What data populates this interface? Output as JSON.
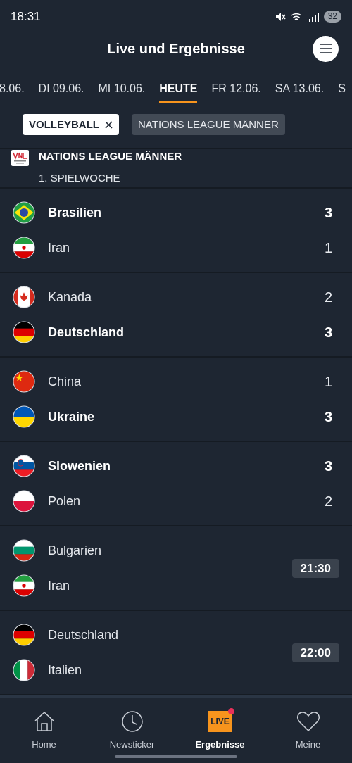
{
  "status_bar": {
    "time": "18:31",
    "battery": "32"
  },
  "header": {
    "title": "Live und Ergebnisse"
  },
  "date_tabs": [
    {
      "label": "8.06.",
      "selected": false
    },
    {
      "label": "DI 09.06.",
      "selected": false
    },
    {
      "label": "MI 10.06.",
      "selected": false
    },
    {
      "label": "HEUTE",
      "selected": true
    },
    {
      "label": "FR 12.06.",
      "selected": false
    },
    {
      "label": "SA 13.06.",
      "selected": false
    },
    {
      "label": "S",
      "selected": false
    }
  ],
  "filters": [
    {
      "label": "VOLLEYBALL",
      "selected": true
    },
    {
      "label": "NATIONS LEAGUE MÄNNER",
      "selected": false
    }
  ],
  "league": {
    "name": "NATIONS LEAGUE MÄNNER",
    "round": "1. SPIELWOCHE"
  },
  "matches": [
    {
      "teams": [
        {
          "name": "Brasilien",
          "kind": "br",
          "score": "3",
          "winner": true
        },
        {
          "name": "Iran",
          "kind": "ir",
          "score": "1",
          "winner": false
        }
      ]
    },
    {
      "teams": [
        {
          "name": "Kanada",
          "kind": "ca",
          "score": "2",
          "winner": false
        },
        {
          "name": "Deutschland",
          "kind": "de",
          "score": "3",
          "winner": true
        }
      ]
    },
    {
      "teams": [
        {
          "name": "China",
          "kind": "cn",
          "score": "1",
          "winner": false
        },
        {
          "name": "Ukraine",
          "kind": "ua",
          "score": "3",
          "winner": true
        }
      ]
    },
    {
      "teams": [
        {
          "name": "Slowenien",
          "kind": "si",
          "score": "3",
          "winner": true
        },
        {
          "name": "Polen",
          "kind": "pl",
          "score": "2",
          "winner": false
        }
      ]
    },
    {
      "time": "21:30",
      "teams": [
        {
          "name": "Bulgarien",
          "kind": "bg"
        },
        {
          "name": "Iran",
          "kind": "ir"
        }
      ]
    },
    {
      "time": "22:00",
      "teams": [
        {
          "name": "Deutschland",
          "kind": "de"
        },
        {
          "name": "Italien",
          "kind": "it"
        }
      ]
    }
  ],
  "bottom_nav": [
    {
      "label": "Home",
      "kind": "home",
      "selected": false
    },
    {
      "label": "Newsticker",
      "kind": "clock",
      "selected": false
    },
    {
      "label": "Ergebnisse",
      "kind": "live",
      "badge": "LIVE",
      "notification": true,
      "selected": true
    },
    {
      "label": "Meine",
      "kind": "heart",
      "selected": false
    }
  ]
}
